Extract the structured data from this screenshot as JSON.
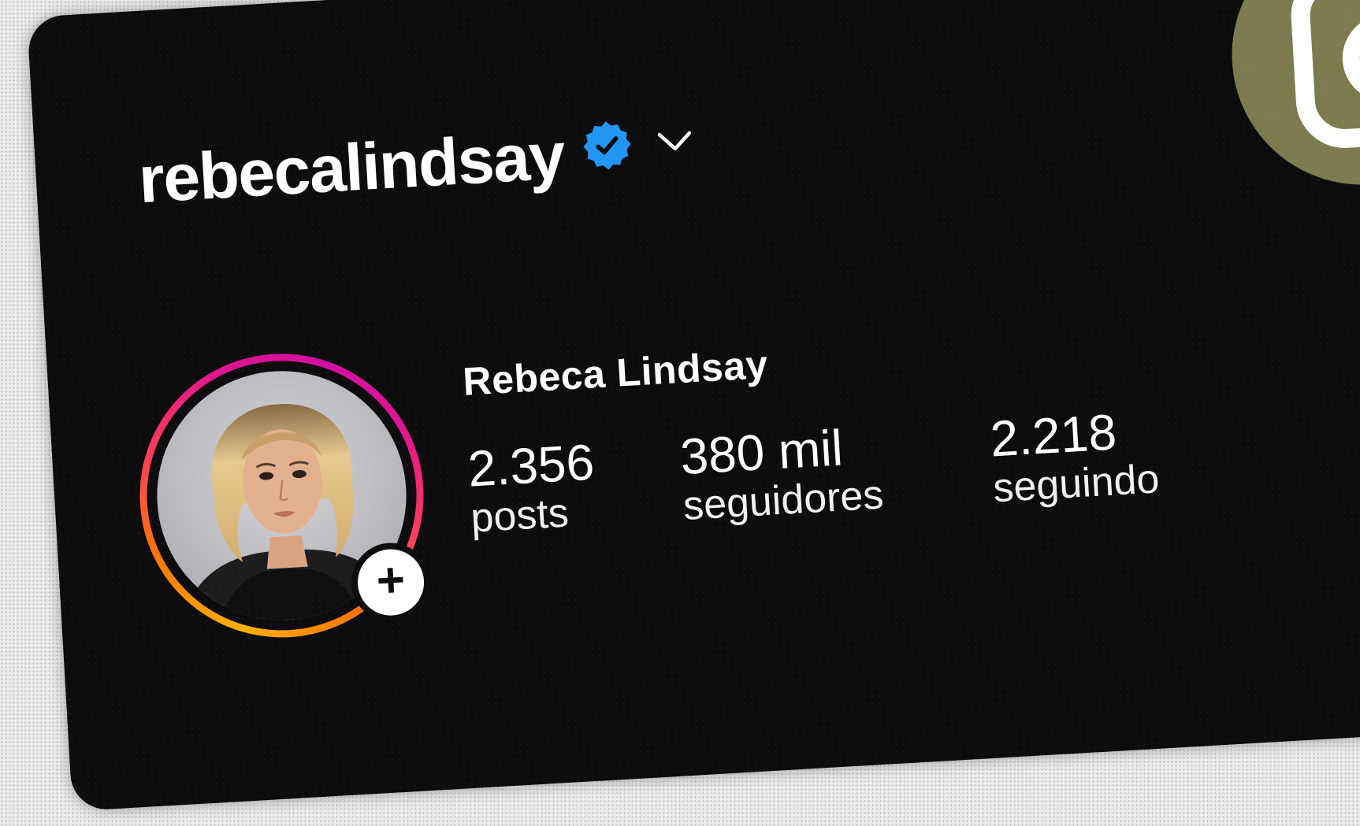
{
  "profile": {
    "username": "rebecalindsay",
    "display_name": "Rebeca Lindsay",
    "verified_icon": "verified-badge-icon",
    "menu_icon": "chevron-down-icon",
    "add_story_icon": "plus-icon",
    "add_story_symbol": "+"
  },
  "stats": {
    "posts": {
      "value": "2.356",
      "label": "posts"
    },
    "followers": {
      "value": "380 mil",
      "label": "seguidores"
    },
    "following": {
      "value": "2.218",
      "label": "seguindo"
    }
  },
  "colors": {
    "card_background": "#0c0c0f",
    "verified_blue": "#2196f3",
    "brand_badge": "#7c7b4d",
    "story_ring": [
      "#ffb000",
      "#ff7a00",
      "#ff3d5a",
      "#e0168f"
    ]
  },
  "brand_icon": "instagram-icon"
}
